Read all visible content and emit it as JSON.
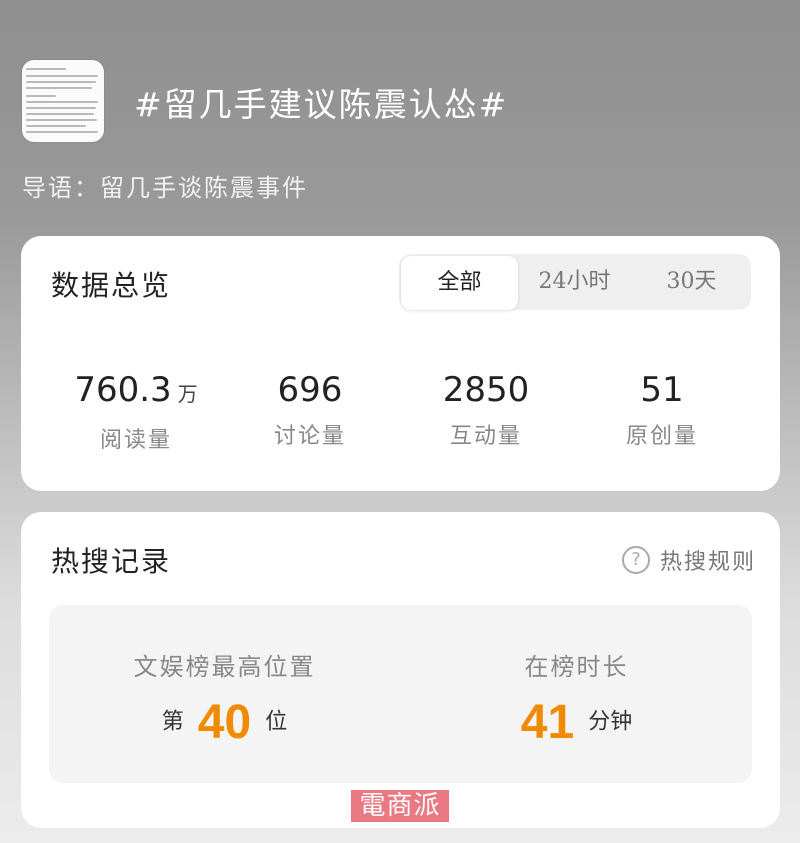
{
  "header": {
    "topic_title": "#留几手建议陈震认怂#",
    "guide": "导语：留几手谈陈震事件"
  },
  "overview": {
    "title": "数据总览",
    "tabs": [
      {
        "label": "全部",
        "active": true
      },
      {
        "label": "24小时",
        "active": false
      },
      {
        "label": "30天",
        "active": false
      }
    ],
    "stats": [
      {
        "value": "760.3",
        "unit": "万",
        "label": "阅读量"
      },
      {
        "value": "696",
        "unit": "",
        "label": "讨论量"
      },
      {
        "value": "2850",
        "unit": "",
        "label": "互动量"
      },
      {
        "value": "51",
        "unit": "",
        "label": "原创量"
      }
    ]
  },
  "trending": {
    "title": "热搜记录",
    "rules_label": "热搜规则",
    "rules_icon": "question-circle-icon",
    "records": [
      {
        "label": "文娱榜最高位置",
        "prefix": "第",
        "value": "40",
        "suffix": "位"
      },
      {
        "label": "在榜时长",
        "prefix": "",
        "value": "41",
        "suffix": "分钟"
      }
    ]
  },
  "watermark": {
    "text": "電商派"
  },
  "colors": {
    "accent": "#f08a00",
    "watermark": "#e8737e"
  }
}
